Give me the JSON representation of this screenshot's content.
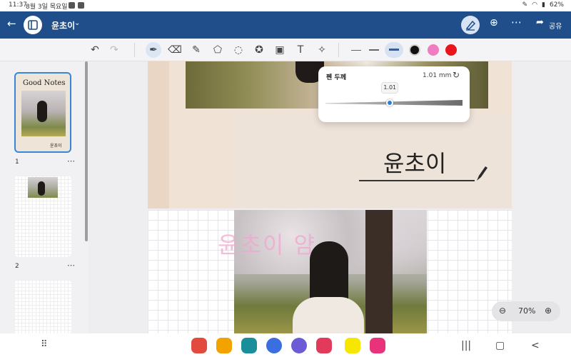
{
  "status_bar": {
    "time": "11:37",
    "date": "8월 3일 목요일",
    "battery": "62%"
  },
  "header": {
    "title": "윤초이",
    "share_label": "공유"
  },
  "thumbnails": [
    {
      "label": "1",
      "cover_title": "Good Notes",
      "cover_sign": "윤초이"
    },
    {
      "label": "2"
    }
  ],
  "page1": {
    "name_text": "윤초이"
  },
  "page2": {
    "pink_text": "윤초이 얌"
  },
  "pen_popup": {
    "title": "펜 두께",
    "value": "1.01 mm",
    "tooltip": "1.01",
    "slider_fraction": 0.47
  },
  "colors": {
    "accent": "#1f4e8a",
    "palette": [
      "#111111",
      "#f07cc2",
      "#e8161c"
    ]
  },
  "zoom": {
    "level": "70%"
  },
  "icons": {
    "back": "arrow-left-icon",
    "sidebar": "sidebar-icon",
    "pen_mode": "pen-mode-icon",
    "add_page": "add-page-icon",
    "more": "more-icon",
    "share": "share-icon",
    "undo": "undo-icon",
    "redo": "redo-icon",
    "pen": "pen-icon",
    "eraser": "eraser-icon",
    "highlighter": "highlighter-icon",
    "shapes": "shapes-icon",
    "lasso": "lasso-icon",
    "sticker": "sticker-icon",
    "image": "image-icon",
    "text": "text-icon",
    "laser": "laser-pointer-icon"
  }
}
